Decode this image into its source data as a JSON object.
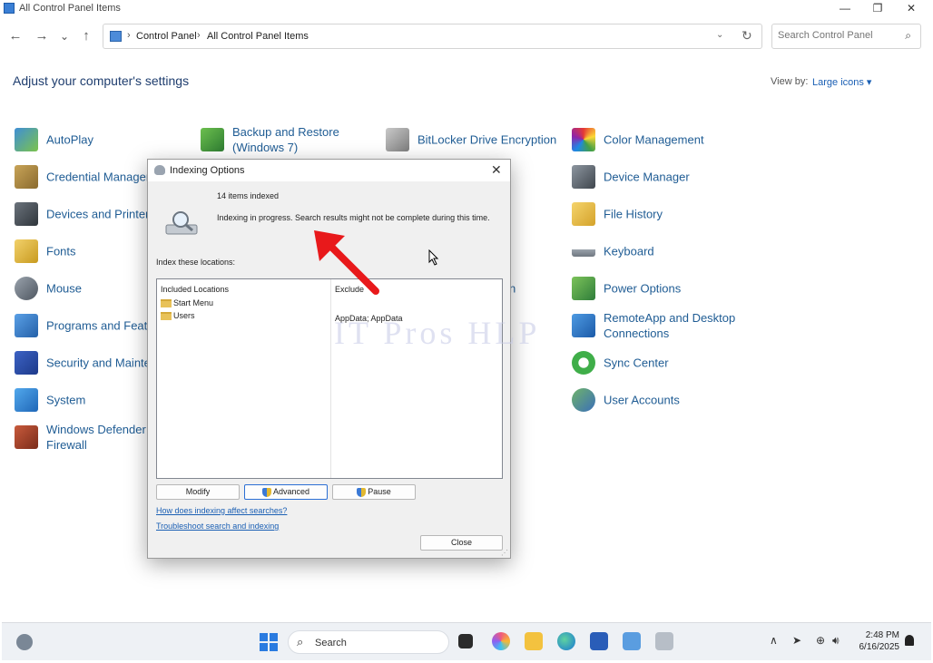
{
  "window": {
    "title": "All Control Panel Items",
    "minimize": "—",
    "restore": "❐",
    "close": "✕"
  },
  "nav": {
    "back": "←",
    "forward": "→",
    "history": "⌄",
    "up": "↑",
    "breadcrumb": [
      "Control Panel",
      "All Control Panel Items"
    ],
    "separator": "›",
    "dropdown": "⌄",
    "refresh": "↻",
    "search_placeholder": "Search Control Panel",
    "search_icon": "⌕"
  },
  "page": {
    "heading": "Adjust your computer's settings",
    "view_by_label": "View by:",
    "view_by_value": "Large icons ▾"
  },
  "items": {
    "autoplay": "AutoPlay",
    "backup_1": "Backup and Restore",
    "backup_2": "(Windows 7)",
    "bitlocker": "BitLocker Drive Encryption",
    "color_mgmt": "Color Management",
    "credential": "Credential Manager",
    "device_mgr": "Device Manager",
    "devices_printers": "Devices and Printers",
    "ons_fragment": "ons",
    "file_history": "File History",
    "fonts": "Fonts",
    "keyboard": "Keyboard",
    "mouse": "Mouse",
    "n_fragment": "n",
    "power": "Power Options",
    "programs": "Programs and Features",
    "remoteapp_1": "RemoteApp and Desktop",
    "remoteapp_2": "Connections",
    "security": "Security and Maintenance",
    "sync": "Sync Center",
    "system": "System",
    "user_accounts": "User Accounts",
    "defender_1": "Windows Defender",
    "defender_2": "Firewall"
  },
  "watermark": "IT Pros HLP",
  "dialog": {
    "title": "Indexing Options",
    "close": "✕",
    "items_indexed": "14 items indexed",
    "status": "Indexing in progress. Search results might not be complete during this time.",
    "locations_label": "Index these locations:",
    "col_included": "Included Locations",
    "col_exclude": "Exclude",
    "locations": [
      "Start Menu",
      "Users"
    ],
    "exclude_value": "AppData; AppData",
    "btn_modify": "Modify",
    "btn_advanced": "Advanced",
    "btn_pause": "Pause",
    "link_affect": "How does indexing affect searches?",
    "link_troubleshoot": "Troubleshoot search and indexing",
    "btn_close": "Close",
    "grip": "⋰"
  },
  "taskbar": {
    "search_label": "Search",
    "search_icon": "⌕",
    "tray_chevron": "∧",
    "tray_location": "➤",
    "tray_network": "⊕",
    "tray_volume": "🔊︎",
    "time": "2:48 PM",
    "date": "6/16/2025"
  },
  "colors": {
    "accent": "#1a5fb4",
    "annotation_arrow": "#e8191b"
  }
}
